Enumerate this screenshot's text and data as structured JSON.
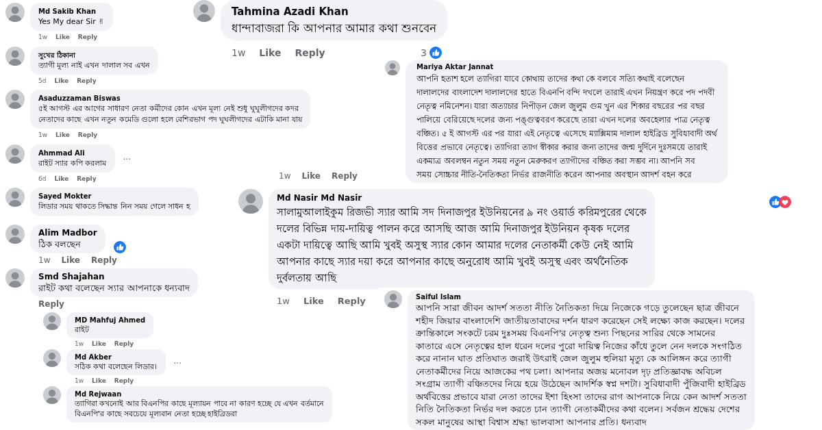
{
  "fragments": [
    {
      "comments": [
        {
          "author": "Md Sakib Khan",
          "lines": [
            "Yes My dear Sir ✌"
          ],
          "time": "1w",
          "actions": [
            "Like",
            "Reply"
          ]
        },
        {
          "author": "সুখের ঠিকানা",
          "lines": [
            "ত্যাগী মুল্য নাই এখন দালাল সব এখন"
          ],
          "time": "5d",
          "actions": [
            "Like",
            "Reply"
          ]
        },
        {
          "author": "Asaduzzaman Biswas",
          "lines": [
            "৫ই আগস্ট এর আগের সাধারণ নেতা কর্মীদের কোন এখন মূল্য নেই শুধু ঘুঘুলীগদের কদর",
            "নেতাদের কাছে এখন নতুন কমেডি গুলো হলে বেশিরভাগ পদ ঘুঘলীগদের এটাকি মানা যায়"
          ],
          "time": "1w",
          "actions": [
            "Like",
            "Reply"
          ]
        },
        {
          "author": "Ahmmad Ali",
          "lines": [
            "রাইট স্যার কপি করলাম"
          ],
          "more": "...",
          "time": "6d",
          "actions": [
            "Like",
            "Reply"
          ]
        },
        {
          "author": "Sayed Mokter",
          "lines": [
            "লিডার সময় থাকতে সিদ্ধান্ত নিন সময় গেলে সাধন হ"
          ]
        }
      ]
    },
    {
      "comments": [
        {
          "author": "Tahmina Azadi Khan",
          "lines": [
            "ধান্দাবাজরা কি আপনার আমার কথা শুনবেন"
          ],
          "time": "1w",
          "actions": [
            "Like",
            "Reply"
          ],
          "reaction_count": "3"
        }
      ]
    },
    {
      "comments": [
        {
          "author": "Mariya Aktar Jannat",
          "lines": [
            "আপনি হতাশ হলে ত্যাগিরা যাবে কোথায় তাদের কথা কে বলবে সত্যি কথাই বলেছেন",
            "দালালদের বাংলাদেশ দালালদের হাতে বিএনপি বন্দি দখলে তারাই এখন নিয়ন্ত্রণ করে পদ পদবী",
            "নেতৃত্ব নমিনেশন। যারা অত্যাচার নিপীড়ন জেল জুলুম গুম খুন এর শিকার বছরের পর বছর",
            "পালিয়ে বেরিয়েছে দলের জন্য পঙ্গুত্ববরণ করেছে তারা এখন দলের অবহেলার পাত্র নেতৃত্ব",
            "বঞ্চিত। ৫ ই আগস্ট এর পর যারা এই নেতৃত্বে এসেছে ম্যাক্সিমাম দালাল হাইব্রিড সুবিধাবাদী অর্থ",
            "বিত্তের প্রভাবে নেতৃত্বে। ত্যাগিরা ত্যাগ স্বীকার করার জন্য তাদের জন্ম দুর্দিনে দুঃসময়ে তারাই",
            "একমাত্র অবলম্বন নতুন সময় নতুন মেরুকরণ ত্যাগীদের বঞ্চিত করা সম্ভব না। আপনি সব",
            "সময় সোচ্চার নীতি-নৈতিকতা নির্ভর রাজনীতি করেন আপনার অবস্থান আদর্শ বহন করে"
          ],
          "time": "1w",
          "actions": [
            "Like",
            "Reply"
          ]
        }
      ]
    },
    {
      "comments": [
        {
          "author": "Alim Madbor",
          "lines": [
            "ঠিক বলছেন"
          ],
          "time": "1w",
          "actions": [
            "Like",
            "Reply"
          ]
        },
        {
          "author": "Smd Shajahan",
          "lines": [
            "রাইট কথা বলেছেন স্যার আপনাকে ধন্যবাদ"
          ],
          "actions": [
            "Reply"
          ]
        }
      ]
    },
    {
      "comments": [
        {
          "author": "Md Nasir Md Nasir",
          "lines": [
            "সালামুআলাইকুম রিজভী স্যার আমি সদ দিনাজপুর ইউনিয়নের ৯ নং ওয়ার্ড করিমপুরের থেকে",
            "দলের বিভিন্ন দায়-দায়িত্ব পালন করে আসছি আজ আমি দিনাজপুর ইউনিয়ন কৃষক দলের",
            "একটা দায়িত্বে আছি আমি খুবই অসুস্থ স্যার কোন আমার দলের নেতাকর্মী কেউ নেই আমি",
            "আপনার কাছে স্যার দয়া করে আপনার কাছে অনুরোধ আমি খুবই অসুস্থ এবং অর্থনৈতিক",
            "দুর্বলতায় আছি"
          ],
          "time": "1w",
          "actions": [
            "Like",
            "Reply"
          ]
        }
      ]
    },
    {
      "comments": [
        {
          "author": "MD Mahfuj Ahmed",
          "lines": [
            "রাইট"
          ],
          "time": "1w",
          "actions": [
            "Like",
            "Reply"
          ]
        },
        {
          "author": "Md Akber",
          "lines": [
            "সঠিক কথা বলেছেন লিডার।"
          ],
          "more": "...",
          "time": "1w",
          "actions": [
            "Like",
            "Reply"
          ]
        },
        {
          "author": "Md Rejwaan",
          "lines": [
            "ত্যাগিরা কখনোই আর বিএনপির কাছে মূল্যায়ন পাবে না কারণ হচ্ছে যে এখন বর্তমানে",
            "বিএনপি'র কাছে সবচেয়ে মূল্যবান নেতা হচ্ছে হাইব্রিডরা"
          ]
        }
      ]
    },
    {
      "comments": [
        {
          "author": "Saiful Islam",
          "lines": [
            "আপনি সারা জীবন আদর্শ সততা নীতি নৈতিকতা দিয়ে নিজেকে গড়ে তুলেছেন ছাত্র জীবনে",
            "শহীদ জিয়ার বাংলাদেশি জাতীয়তাবাদের দর্শন ধারণ করেছেন সেই লক্ষ্যে কাজ করছেন। দলের",
            "ক্রান্তিকালে সংকটে চরম দুঃসময় বিএনপি'র নেতৃত্ব শুন্য পিছনের সারির থেকে সামনের",
            "কাতারে এসে নেতৃত্বের হাল ধরেন দলের পুরো দায়িত্ব নিজের কাঁধে তুলে নেন দলকে সংগঠিত",
            "করে নানান ঘাত প্রতিঘাত জরাই উৎরাই জেল জুলুম হুলিয়া মৃত্যু কে আলিঙ্গন করে ত্যাগী",
            "নেতাকর্মীদের নিয়ে আজকের পথ চলা। আপনার অজয় মনোবল দৃঢ় প্রতিজ্ঞাবদ্ধ অবিচল",
            "সংগ্রাম ত্যাগী বঞ্চিতদের নিয়ে হয়ে উঠেছেন আদর্শিক স্বপ্ন দশটা। সুবিধাবাদী পুঁজিবাদী হাইব্রিড",
            "অর্থবিত্তের প্রভাবে যারা নেতা তাদের ইশা হিংসা তাদের রাগ আপনাকে নিয়ে কেন আদর্শ সততা",
            "নিতি নৈতিকতা নির্ভর দল করতে চান ত্যাগী নেতাকর্মীদের কথা বলেন। সর্বজন শ্রদ্ধেয় দেশের",
            "সকল মানুষের আস্থা বিশ্বাস শ্রদ্ধা ভালবাসা আপনার প্রতি। ধন্যবাদ"
          ]
        }
      ]
    }
  ]
}
